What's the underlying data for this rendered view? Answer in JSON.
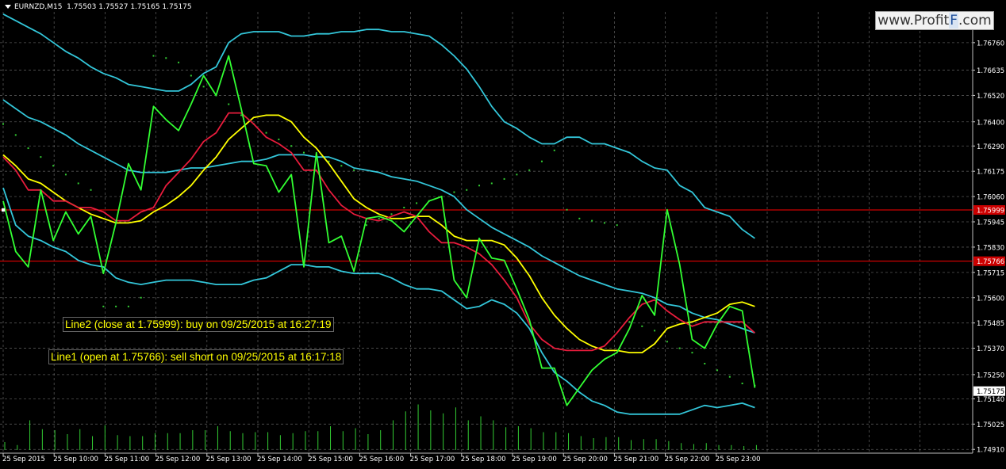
{
  "chart_header": {
    "symbol_info": "EURNZD,M15",
    "ohlc": "1.75503 1.75527 1.75165 1.75175"
  },
  "watermark": {
    "prefix": "www.Profit",
    "highlight": "F",
    "suffix": ".com"
  },
  "annotations": [
    {
      "id": "line2",
      "text": "Line2 (close at 1.75999): buy on 09/25/2015 at 16:27:19"
    },
    {
      "id": "line1",
      "text": "Line1 (open at 1.75766): sell short on 09/25/2015 at 16:17:18"
    }
  ],
  "price_markers": {
    "line2_price": "1.75999",
    "line1_price": "1.75766",
    "current_price": "1.75175"
  },
  "colors": {
    "background": "#000000",
    "grid": "#9a9a9a",
    "price_line": "#32ff32",
    "ma_fast": "#e81c3c",
    "ma_slow": "#ffff00",
    "bollinger": "#33c6d9",
    "sar_dots": "#33cc33",
    "volume": "#33cc33",
    "hline": "#ff0000",
    "axis_text": "#ffffff",
    "annotation_text": "#ffff00"
  },
  "chart_data": {
    "type": "line",
    "ylim": [
      1.749,
      1.769
    ],
    "y_ticks": [
      "1.76760",
      "1.76635",
      "1.76520",
      "1.76400",
      "1.76290",
      "1.76175",
      "1.76060",
      "1.75945",
      "1.75830",
      "1.75715",
      "1.75600",
      "1.75485",
      "1.75370",
      "1.75250",
      "1.75140",
      "1.75025",
      "1.74910"
    ],
    "x_ticks": [
      "25 Sep 2015",
      "25 Sep 10:00",
      "25 Sep 11:00",
      "25 Sep 12:00",
      "25 Sep 13:00",
      "25 Sep 14:00",
      "25 Sep 15:00",
      "25 Sep 16:00",
      "25 Sep 17:00",
      "25 Sep 18:00",
      "25 Sep 19:00",
      "25 Sep 20:00",
      "25 Sep 21:00",
      "25 Sep 22:00",
      "25 Sep 23:00"
    ],
    "hlines": [
      1.75999,
      1.75766
    ],
    "series": [
      {
        "values": [
          1.7604,
          1.7581,
          1.7574,
          1.7609,
          1.7586,
          1.7599,
          1.7589,
          1.7597,
          1.7571,
          1.7594,
          1.7621,
          1.7609,
          1.7647,
          1.7641,
          1.7636,
          1.7648,
          1.7661,
          1.7652,
          1.767,
          1.7646,
          1.7621,
          1.762,
          1.7608,
          1.7616,
          1.7574,
          1.7626,
          1.7585,
          1.7588,
          1.7572,
          1.7596,
          1.7597,
          1.7595,
          1.759,
          1.7597,
          1.7604,
          1.7606,
          1.7568,
          1.756,
          1.7587,
          1.7578,
          1.7577,
          1.7564,
          1.755,
          1.7528,
          1.7528,
          1.7511,
          1.7519,
          1.7527,
          1.7532,
          1.7535,
          1.7546,
          1.7561,
          1.7552,
          1.76,
          1.7575,
          1.7541,
          1.7537,
          1.7548,
          1.7556,
          1.7554,
          1.7519
        ]
      },
      {
        "values": [
          1.7624,
          1.7618,
          1.7609,
          1.7609,
          1.7604,
          1.7604,
          1.7601,
          1.7601,
          1.7599,
          1.7595,
          1.7595,
          1.7599,
          1.7601,
          1.7611,
          1.7617,
          1.7623,
          1.7631,
          1.7635,
          1.7644,
          1.7644,
          1.7639,
          1.7633,
          1.763,
          1.7626,
          1.7618,
          1.7618,
          1.7609,
          1.7602,
          1.7598,
          1.7596,
          1.7595,
          1.7597,
          1.7599,
          1.7597,
          1.759,
          1.7585,
          1.7585,
          1.7583,
          1.758,
          1.7575,
          1.7568,
          1.756,
          1.7548,
          1.7541,
          1.7537,
          1.7536,
          1.7536,
          1.7536,
          1.7538,
          1.7544,
          1.7551,
          1.7557,
          1.7559,
          1.7554,
          1.755,
          1.7547,
          1.7549,
          1.7549,
          1.7549,
          1.7549,
          1.7544
        ]
      },
      {
        "values": [
          1.7625,
          1.762,
          1.7614,
          1.7612,
          1.7608,
          1.7604,
          1.7601,
          1.7598,
          1.7596,
          1.7594,
          1.7594,
          1.7595,
          1.7599,
          1.7602,
          1.7606,
          1.7611,
          1.7618,
          1.7624,
          1.7632,
          1.7637,
          1.7642,
          1.7643,
          1.7643,
          1.764,
          1.7633,
          1.7628,
          1.7621,
          1.7613,
          1.7605,
          1.7601,
          1.7598,
          1.7596,
          1.7596,
          1.7597,
          1.7597,
          1.7593,
          1.7588,
          1.7586,
          1.7586,
          1.7586,
          1.7584,
          1.7578,
          1.757,
          1.756,
          1.7552,
          1.7546,
          1.7541,
          1.7538,
          1.7536,
          1.7536,
          1.7535,
          1.7535,
          1.7539,
          1.7546,
          1.7548,
          1.7549,
          1.7551,
          1.7553,
          1.7557,
          1.7558,
          1.7556
        ]
      },
      {
        "values": [
          1.765,
          1.7646,
          1.7642,
          1.764,
          1.7637,
          1.7634,
          1.763,
          1.7627,
          1.7624,
          1.7621,
          1.7618,
          1.7617,
          1.7617,
          1.7617,
          1.7618,
          1.7619,
          1.7619,
          1.762,
          1.7621,
          1.7622,
          1.7622,
          1.7623,
          1.7625,
          1.7625,
          1.7625,
          1.7624,
          1.7624,
          1.7622,
          1.7619,
          1.7618,
          1.7617,
          1.7615,
          1.7614,
          1.7613,
          1.7611,
          1.7609,
          1.7606,
          1.76,
          1.7596,
          1.7592,
          1.7589,
          1.7586,
          1.7583,
          1.7579,
          1.7576,
          1.7573,
          1.757,
          1.7568,
          1.7566,
          1.7564,
          1.7563,
          1.7562,
          1.756,
          1.7557,
          1.7556,
          1.7553,
          1.7551,
          1.755,
          1.7548,
          1.7546,
          1.7544
        ]
      },
      {
        "values": [
          1.7689,
          1.7686,
          1.7683,
          1.768,
          1.7676,
          1.7672,
          1.7669,
          1.7665,
          1.7662,
          1.766,
          1.7657,
          1.7656,
          1.7655,
          1.7654,
          1.7654,
          1.7657,
          1.7662,
          1.7665,
          1.7676,
          1.768,
          1.7681,
          1.7681,
          1.7681,
          1.7679,
          1.7679,
          1.768,
          1.768,
          1.7681,
          1.7681,
          1.7682,
          1.7682,
          1.7681,
          1.7681,
          1.768,
          1.7679,
          1.7675,
          1.767,
          1.7664,
          1.7656,
          1.7647,
          1.764,
          1.7637,
          1.7633,
          1.763,
          1.763,
          1.7633,
          1.7633,
          1.763,
          1.763,
          1.7628,
          1.7626,
          1.7622,
          1.7619,
          1.7618,
          1.7611,
          1.7608,
          1.7601,
          1.7599,
          1.7597,
          1.7591,
          1.7587
        ]
      },
      {
        "values": [
          1.761,
          1.7593,
          1.7588,
          1.7586,
          1.7583,
          1.7581,
          1.7577,
          1.7575,
          1.7574,
          1.7569,
          1.7567,
          1.7566,
          1.7567,
          1.7568,
          1.7568,
          1.7568,
          1.7567,
          1.7566,
          1.7566,
          1.7566,
          1.7568,
          1.7569,
          1.7572,
          1.7575,
          1.7575,
          1.7574,
          1.7574,
          1.7572,
          1.7571,
          1.7571,
          1.7571,
          1.7569,
          1.7566,
          1.7564,
          1.7564,
          1.7563,
          1.7559,
          1.7555,
          1.7556,
          1.7559,
          1.7557,
          1.7553,
          1.7546,
          1.7535,
          1.7526,
          1.7522,
          1.7517,
          1.7513,
          1.7511,
          1.7508,
          1.7507,
          1.7507,
          1.7507,
          1.7507,
          1.7507,
          1.7509,
          1.7511,
          1.751,
          1.7511,
          1.7512,
          1.751
        ]
      },
      {
        "values": [
          1.7639,
          1.7634,
          1.7628,
          1.7624,
          1.762,
          1.7616,
          1.7612,
          1.7609,
          1.7556,
          1.7556,
          1.7556,
          1.756,
          1.767,
          1.7669,
          1.7667,
          1.7661,
          1.7656,
          1.7652,
          1.7648,
          1.7643,
          1.7639,
          1.7635,
          1.7632,
          1.7629,
          1.7626,
          1.7624,
          1.7622,
          1.762,
          1.7618,
          1.7593,
          1.7596,
          1.7598,
          1.7601,
          1.7603,
          1.7604,
          1.7606,
          1.7608,
          1.7609,
          1.7611,
          1.7612,
          1.7614,
          1.7616,
          1.7618,
          1.7622,
          1.7627,
          1.76,
          1.7596,
          1.7595,
          1.7594,
          1.7593,
          1.7549,
          1.7547,
          1.7545,
          1.754,
          1.7537,
          1.7535,
          1.753,
          1.7527,
          1.7524,
          1.7521,
          1.752
        ]
      },
      {
        "values": [
          0.08,
          0.05,
          0.3,
          0.21,
          0.2,
          0.16,
          0.21,
          0.14,
          0.25,
          0.15,
          0.14,
          0.14,
          0.17,
          0.17,
          0.17,
          0.2,
          0.2,
          0.24,
          0.19,
          0.17,
          0.18,
          0.18,
          0.15,
          0.17,
          0.19,
          0.19,
          0.24,
          0.19,
          0.22,
          0.16,
          0.2,
          0.3,
          0.39,
          0.46,
          0.4,
          0.37,
          0.43,
          0.3,
          0.34,
          0.3,
          0.23,
          0.24,
          0.22,
          0.18,
          0.18,
          0.17,
          0.14,
          0.12,
          0.13,
          0.13,
          0.1,
          0.11,
          0.11,
          0.09,
          0.07,
          0.06,
          0.07,
          0.05,
          0.05,
          0.04,
          0.05
        ]
      }
    ]
  }
}
